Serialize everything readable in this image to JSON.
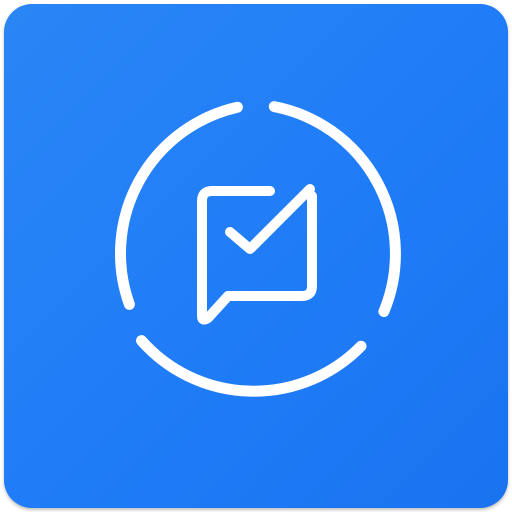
{
  "app_icon": {
    "background_color": "#1f7cf7",
    "glyph_color": "#ffffff",
    "icon": "chat-bubble-checkmark-icon",
    "ring": "segmented-ring-icon"
  }
}
